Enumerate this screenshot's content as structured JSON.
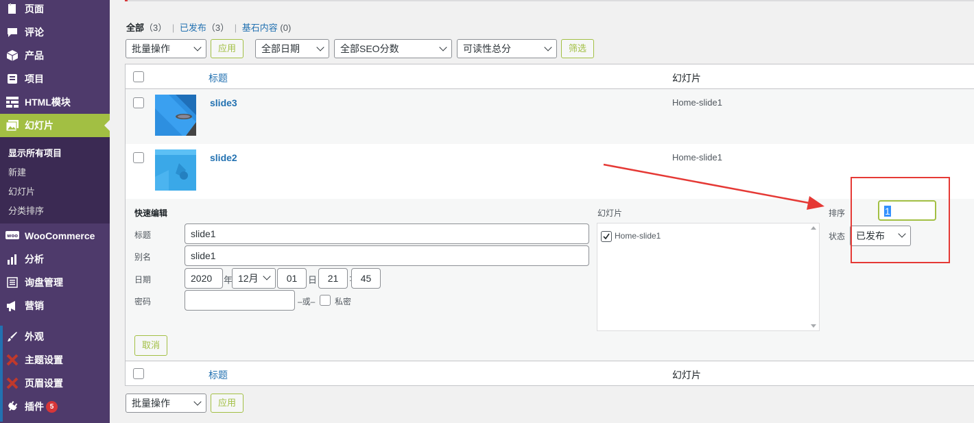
{
  "sidebar": {
    "items": [
      {
        "label": "页面",
        "icon": "page-icon"
      },
      {
        "label": "评论",
        "icon": "comment-icon"
      },
      {
        "label": "产品",
        "icon": "product-icon"
      },
      {
        "label": "项目",
        "icon": "project-icon"
      },
      {
        "label": "HTML模块",
        "icon": "html-module-icon"
      },
      {
        "label": "幻灯片",
        "icon": "slides-icon"
      },
      {
        "label": "WooCommerce",
        "icon": "woocommerce-icon"
      },
      {
        "label": "分析",
        "icon": "analytics-icon"
      },
      {
        "label": "询盘管理",
        "icon": "inquiry-icon"
      },
      {
        "label": "营销",
        "icon": "marketing-icon"
      },
      {
        "label": "外观",
        "icon": "appearance-icon"
      },
      {
        "label": "主题设置",
        "icon": "theme-settings-icon"
      },
      {
        "label": "页眉设置",
        "icon": "header-settings-icon"
      },
      {
        "label": "插件",
        "icon": "plugins-icon",
        "badge": "5"
      }
    ],
    "submenu": [
      "显示所有项目",
      "新建",
      "幻灯片",
      "分类排序"
    ]
  },
  "filters": {
    "all": "全部",
    "all_count": "（3）",
    "published": "已发布",
    "published_count": "（3）",
    "cornerstone": "基石内容",
    "cornerstone_count": "(0)",
    "bulk_action": "批量操作",
    "apply": "应用",
    "all_dates": "全部日期",
    "all_seo": "全部SEO分数",
    "readability": "可读性总分",
    "filter": "筛选"
  },
  "table": {
    "col_title": "标题",
    "col_slides": "幻灯片",
    "rows": [
      {
        "title": "slide3",
        "slides": "Home-slide1"
      },
      {
        "title": "slide2",
        "slides": "Home-slide1"
      }
    ]
  },
  "quick_edit": {
    "heading": "快速编辑",
    "title_label": "标题",
    "title_value": "slide1",
    "slug_label": "别名",
    "slug_value": "slide1",
    "date_label": "日期",
    "year": "2020",
    "year_unit": "年",
    "month": "12月",
    "day": "01",
    "day_unit": "日",
    "hour": "21",
    "time_sep": ":",
    "minute": "45",
    "password_label": "密码",
    "or_text": "–或–",
    "private_label": "私密",
    "slides_heading": "幻灯片",
    "slides_option": "Home-slide1",
    "order_label": "排序",
    "order_value": "1",
    "status_label": "状态",
    "status_value": "已发布",
    "cancel": "取消"
  },
  "colors": {
    "accent": "#a2bf43",
    "sidebar": "#4e3a6b",
    "link": "#2271b1",
    "annotation": "#e53935"
  }
}
